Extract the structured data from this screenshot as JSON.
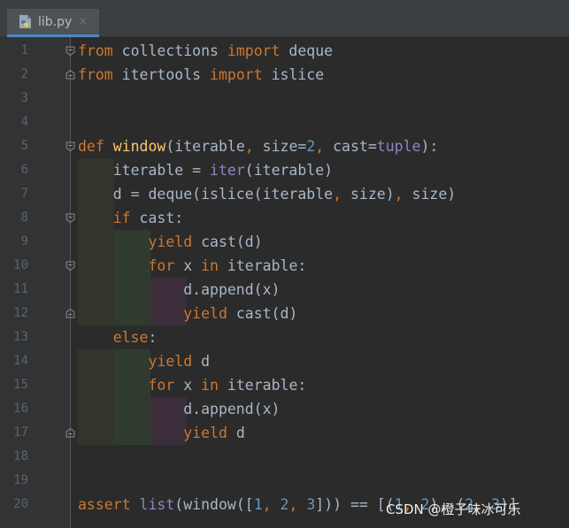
{
  "tab": {
    "filename": "lib.py",
    "close": "×",
    "icon": "python-file-icon"
  },
  "code_lines": [
    {
      "n": "1",
      "t": [
        [
          "from",
          "kw"
        ],
        [
          " collections ",
          ""
        ],
        [
          "import",
          "kw"
        ],
        [
          " deque",
          ""
        ]
      ]
    },
    {
      "n": "2",
      "t": [
        [
          "from",
          "kw"
        ],
        [
          " itertools ",
          ""
        ],
        [
          "import",
          "kw"
        ],
        [
          " islice",
          ""
        ]
      ]
    },
    {
      "n": "3",
      "t": []
    },
    {
      "n": "4",
      "t": []
    },
    {
      "n": "5",
      "t": [
        [
          "def",
          "kw"
        ],
        [
          " ",
          ""
        ],
        [
          "window",
          "fn"
        ],
        [
          "(iterable",
          ""
        ],
        [
          ", ",
          "kw"
        ],
        [
          "size=",
          ""
        ],
        [
          "2",
          "num"
        ],
        [
          ", ",
          "kw"
        ],
        [
          "cast=",
          ""
        ],
        [
          "tuple",
          "bi"
        ],
        [
          "):",
          ""
        ]
      ]
    },
    {
      "n": "6",
      "t": [
        [
          "    iterable = ",
          ""
        ],
        [
          "iter",
          "bi"
        ],
        [
          "(iterable)",
          ""
        ]
      ]
    },
    {
      "n": "7",
      "t": [
        [
          "    d = deque(islice(iterable",
          ""
        ],
        [
          ", ",
          "kw"
        ],
        [
          "size)",
          ""
        ],
        [
          ", ",
          "kw"
        ],
        [
          "size)",
          ""
        ]
      ]
    },
    {
      "n": "8",
      "t": [
        [
          "    ",
          ""
        ],
        [
          "if",
          "kw"
        ],
        [
          " cast:",
          ""
        ]
      ]
    },
    {
      "n": "9",
      "t": [
        [
          "        ",
          ""
        ],
        [
          "yield",
          "kw"
        ],
        [
          " cast(d)",
          ""
        ]
      ]
    },
    {
      "n": "10",
      "t": [
        [
          "        ",
          ""
        ],
        [
          "for",
          "kw"
        ],
        [
          " x ",
          ""
        ],
        [
          "in",
          "kw"
        ],
        [
          " iterable:",
          ""
        ]
      ]
    },
    {
      "n": "11",
      "t": [
        [
          "            d.append(x)",
          ""
        ]
      ]
    },
    {
      "n": "12",
      "t": [
        [
          "            ",
          ""
        ],
        [
          "yield",
          "kw"
        ],
        [
          " cast(d)",
          ""
        ]
      ]
    },
    {
      "n": "13",
      "t": [
        [
          "    ",
          ""
        ],
        [
          "else",
          "kw"
        ],
        [
          ":",
          ""
        ]
      ]
    },
    {
      "n": "14",
      "t": [
        [
          "        ",
          ""
        ],
        [
          "yield",
          "kw"
        ],
        [
          " d",
          ""
        ]
      ]
    },
    {
      "n": "15",
      "t": [
        [
          "        ",
          ""
        ],
        [
          "for",
          "kw"
        ],
        [
          " x ",
          ""
        ],
        [
          "in",
          "kw"
        ],
        [
          " iterable:",
          ""
        ]
      ]
    },
    {
      "n": "16",
      "t": [
        [
          "            d.append(x)",
          ""
        ]
      ]
    },
    {
      "n": "17",
      "t": [
        [
          "            ",
          ""
        ],
        [
          "yield",
          "kw"
        ],
        [
          " d",
          ""
        ]
      ]
    },
    {
      "n": "18",
      "t": []
    },
    {
      "n": "19",
      "t": []
    },
    {
      "n": "20",
      "t": [
        [
          "assert",
          "kw"
        ],
        [
          " ",
          ""
        ],
        [
          "list",
          "bi"
        ],
        [
          "(window([",
          ""
        ],
        [
          "1",
          "num"
        ],
        [
          ", ",
          "kw"
        ],
        [
          "2",
          "num"
        ],
        [
          ", ",
          "kw"
        ],
        [
          "3",
          "num"
        ],
        [
          "])) == [(",
          ""
        ],
        [
          "1",
          "num"
        ],
        [
          ", ",
          "kw"
        ],
        [
          "2",
          "num"
        ],
        [
          "), (",
          ""
        ],
        [
          "2",
          "num"
        ],
        [
          ", ",
          "kw"
        ],
        [
          "3",
          "num"
        ],
        [
          ")]",
          ""
        ]
      ]
    }
  ],
  "watermark": "CSDN @橙子味冰可乐",
  "colors": {
    "background": "#2b2b2b",
    "keyword": "#cc7832",
    "function": "#ffc66d",
    "builtin": "#8888c6",
    "number": "#6897bb",
    "text": "#a9b7c6"
  }
}
